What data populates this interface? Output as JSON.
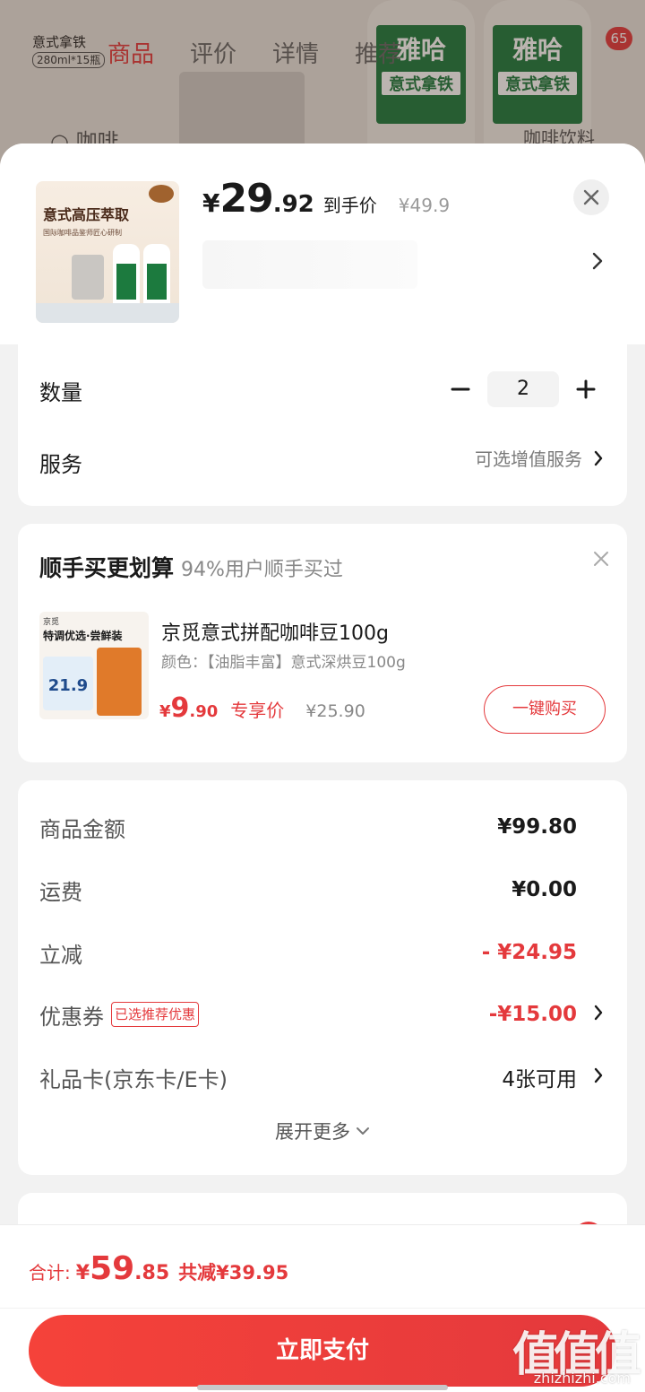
{
  "background_page": {
    "product_title": "意式拿铁",
    "product_spec": "280ml*15瓶",
    "tabs": [
      "商品",
      "评价",
      "详情",
      "推荐"
    ],
    "cart_badge": "65",
    "search_hint": "咖啡",
    "search_hint_right": "咖啡饮料"
  },
  "product": {
    "thumbnail_caption": "意式高压萃取",
    "thumbnail_subcaption": "国际咖啡品鉴师匠心研制",
    "price_symbol": "¥",
    "price_integer": "29",
    "price_decimal": ".92",
    "price_tag": "到手价",
    "original_price": "¥49.9"
  },
  "quantity": {
    "label": "数量",
    "value": "2"
  },
  "service": {
    "label": "服务",
    "value": "可选增值服务"
  },
  "recommendation": {
    "title": "顺手买更划算",
    "subtitle": "94%用户顺手买过",
    "image_brand": "京觅",
    "image_headline": "特调优选·尝鲜装",
    "image_promo_price": "21.9",
    "item_name": "京觅意式拼配咖啡豆100g",
    "item_spec": "颜色：【油脂丰富】意式深烘豆100g",
    "price_symbol": "¥",
    "price_integer": "9",
    "price_decimal": ".90",
    "price_tag": "专享价",
    "original_price": "¥25.90",
    "buy_button": "一键购买"
  },
  "summary": {
    "goods_amount": {
      "label": "商品金额",
      "value": "¥99.80"
    },
    "shipping": {
      "label": "运费",
      "value": "¥0.00"
    },
    "instant_discount": {
      "label": "立减",
      "value": "- ¥24.95"
    },
    "coupon": {
      "label": "优惠券",
      "tag": "已选推荐优惠",
      "value": "-¥15.00"
    },
    "gift_card": {
      "label": "礼品卡(京东卡/E卡)",
      "value": "4张可用"
    },
    "expand_label": "展开更多"
  },
  "footer": {
    "total_label": "合计:",
    "total_symbol": "¥",
    "total_integer": "59",
    "total_decimal": ".85",
    "total_saving": "共减¥39.95",
    "pay_button": "立即支付"
  },
  "watermark": {
    "main": "值值值",
    "sub": "zhizhizhi.com"
  },
  "colors": {
    "accent": "#e4393c",
    "background": "#f2f2f2",
    "card": "#ffffff"
  },
  "icons": [
    "close-icon",
    "chevron-right-icon",
    "minus-icon",
    "plus-icon",
    "chevron-down-icon"
  ]
}
